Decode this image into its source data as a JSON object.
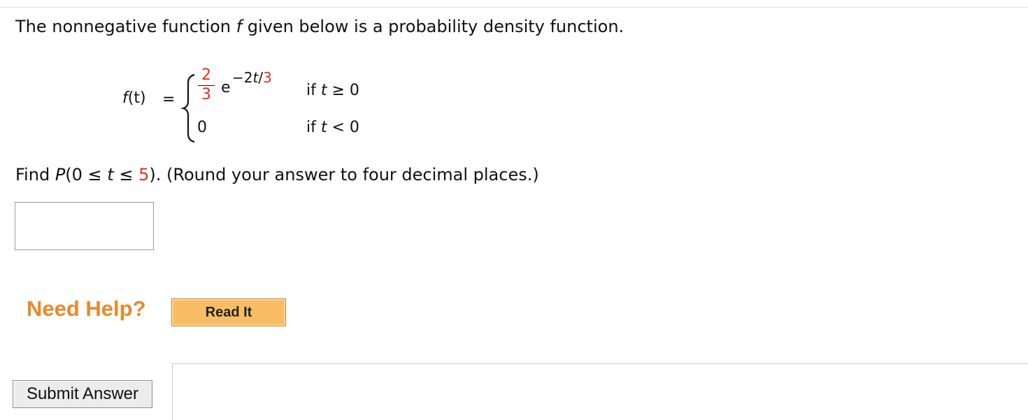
{
  "question": {
    "intro_before": "The nonnegative function ",
    "intro_var": "f",
    "intro_after": " given below is a probability density function.",
    "function": {
      "lhs_name": "f",
      "lhs_arg": "(t)",
      "equals": "=",
      "numerator": "2",
      "denominator": "3",
      "base": "e",
      "exponent_prefix": "−2",
      "exponent_var": "t",
      "exponent_div": "/",
      "exponent_denominator": "3",
      "case1_if": "if ",
      "case1_var": "t",
      "case1_rel": " ≥ 0",
      "case2_value": "0",
      "case2_if": "if ",
      "case2_var": "t",
      "case2_rel": " < 0"
    },
    "prompt_find": "Find ",
    "prompt_P": "P",
    "prompt_open": "(0 ≤ ",
    "prompt_t": "t",
    "prompt_le": " ≤ ",
    "prompt_upper": "5",
    "prompt_close": ").",
    "prompt_rest": " (Round your answer to four decimal places.)"
  },
  "answer": {
    "value": ""
  },
  "help": {
    "label": "Need Help?",
    "read_it": "Read It"
  },
  "submit": {
    "label": "Submit Answer"
  },
  "colors": {
    "accent_red": "#e03121",
    "help_orange": "#e8892a",
    "read_it_bg": "#f8bd64"
  }
}
